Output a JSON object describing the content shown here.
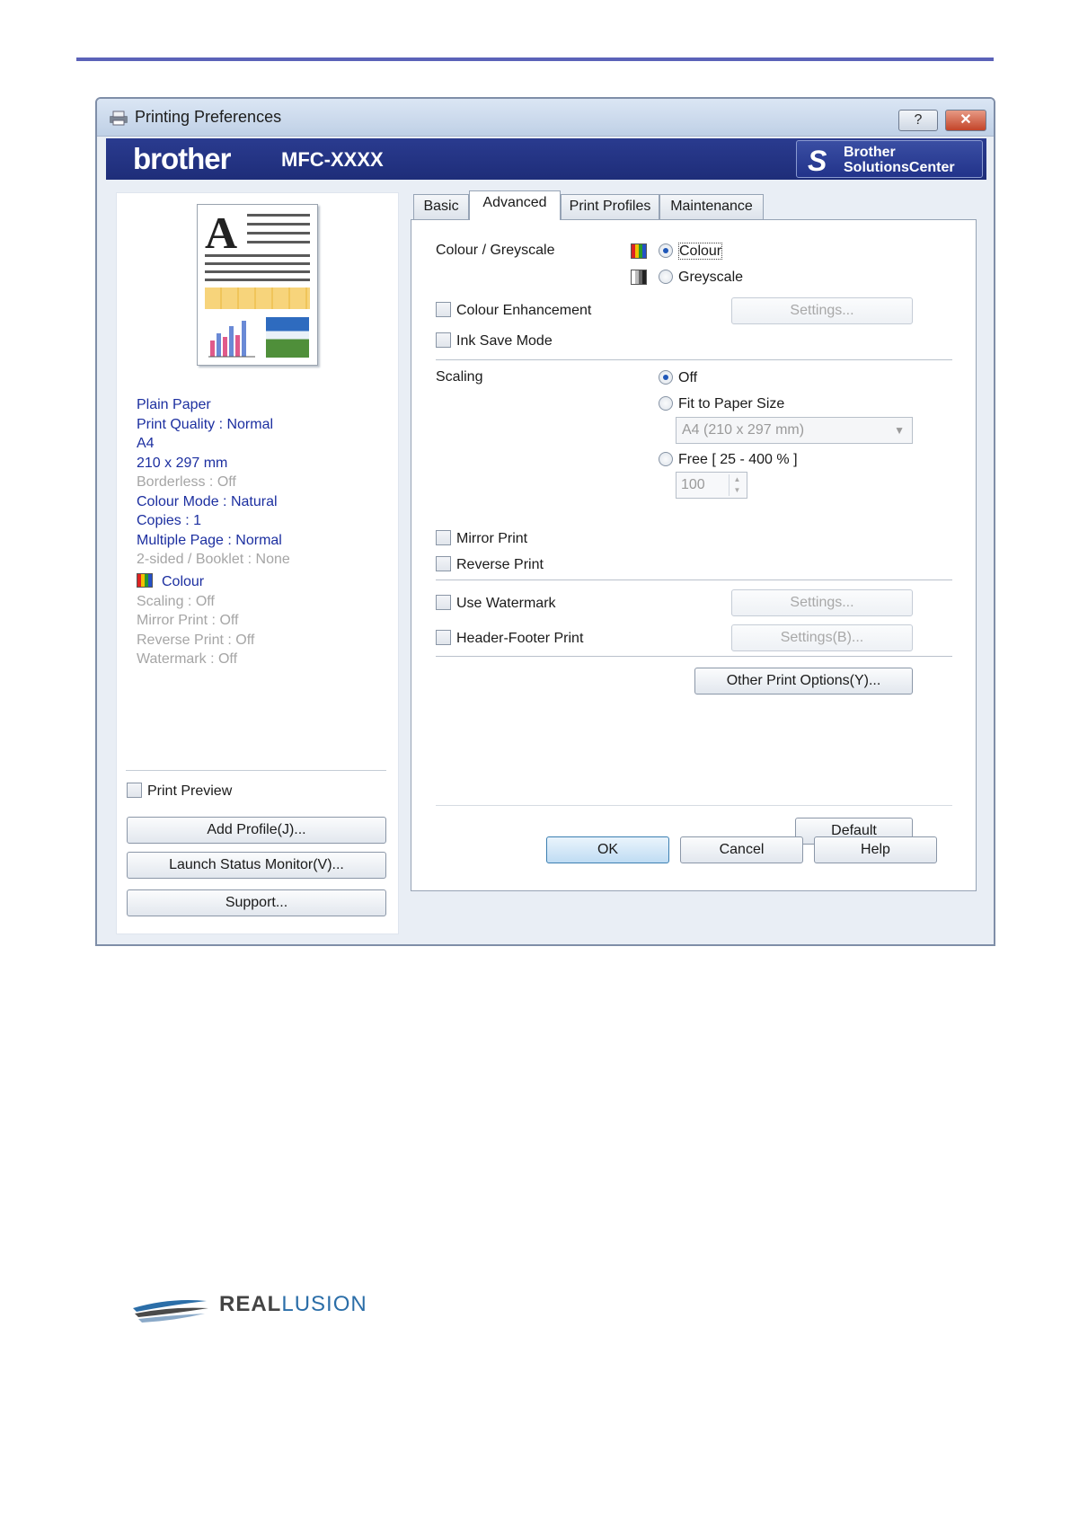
{
  "window": {
    "title": "Printing Preferences",
    "help_label": "?",
    "close_label": "✕"
  },
  "brand": {
    "logo": "brother",
    "model": "MFC-XXXX",
    "solutions_line1": "Brother",
    "solutions_line2": "SolutionsCenter"
  },
  "summary": {
    "items": [
      {
        "text": "Plain Paper",
        "active": true
      },
      {
        "text": "Print Quality : Normal",
        "active": true
      },
      {
        "text": "A4",
        "active": true
      },
      {
        "text": "210 x 297 mm",
        "active": true
      },
      {
        "text": "Borderless : Off",
        "active": false
      },
      {
        "text": "Colour Mode : Natural",
        "active": true
      },
      {
        "text": "Copies : 1",
        "active": true
      },
      {
        "text": "Multiple Page : Normal",
        "active": true
      },
      {
        "text": "2-sided / Booklet : None",
        "active": false
      }
    ],
    "colour_label": "Colour",
    "items2": [
      {
        "text": "Scaling : Off"
      },
      {
        "text": "Mirror Print : Off"
      },
      {
        "text": "Reverse Print : Off"
      },
      {
        "text": "Watermark : Off"
      }
    ]
  },
  "left_actions": {
    "print_preview": "Print Preview",
    "add_profile": "Add Profile(J)...",
    "launch_status_monitor": "Launch Status Monitor(V)...",
    "support": "Support..."
  },
  "tabs": [
    {
      "label": "Basic",
      "active": false
    },
    {
      "label": "Advanced",
      "active": true
    },
    {
      "label": "Print Profiles",
      "active": false
    },
    {
      "label": "Maintenance",
      "active": false
    }
  ],
  "advanced": {
    "colour_greyscale_label": "Colour / Greyscale",
    "colour_option": "Colour",
    "greyscale_option": "Greyscale",
    "colour_enhancement": "Colour Enhancement",
    "settings_label": "Settings...",
    "ink_save_mode": "Ink Save Mode",
    "scaling_label": "Scaling",
    "scaling_off": "Off",
    "fit_to_paper": "Fit to Paper Size",
    "paper_size_value": "A4 (210 x 297 mm)",
    "free_option": "Free [ 25 - 400 % ]",
    "free_value": "100",
    "mirror_print": "Mirror Print",
    "reverse_print": "Reverse Print",
    "use_watermark": "Use Watermark",
    "watermark_settings": "Settings...",
    "header_footer": "Header-Footer Print",
    "header_footer_settings": "Settings(B)...",
    "other_print_options": "Other Print Options(Y)...",
    "default_label": "Default"
  },
  "dialog_buttons": {
    "ok": "OK",
    "cancel": "Cancel",
    "help": "Help"
  },
  "footer": {
    "logo_strong": "REAL",
    "logo_light": "LUSION"
  },
  "colors": {
    "accent_rule": "#5b62b8",
    "brand_bar": "#1e2d79",
    "active_text": "#1c2fa0",
    "inactive_text": "#a5a5a5"
  }
}
